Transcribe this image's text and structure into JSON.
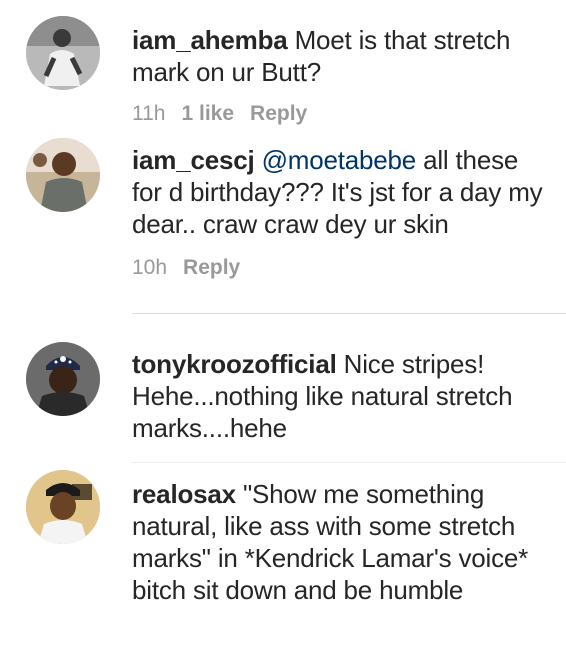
{
  "comments": [
    {
      "username": "iam_ahemba",
      "text": "Moet is that stretch mark on ur Butt?",
      "time": "11h",
      "likes": "1 like",
      "reply": "Reply"
    },
    {
      "username": "iam_cescj",
      "mention": "@moetabebe",
      "text": "all these for d birthday??? It's jst for a day my dear.. craw craw dey ur skin",
      "time": "10h",
      "reply": "Reply"
    },
    {
      "username": "tonykroozofficial",
      "text": "Nice stripes! Hehe...nothing like natural stretch marks....hehe"
    },
    {
      "username": "realosax",
      "text": "\"Show me something natural, like ass with some stretch marks\" in *Kendrick Lamar's voice* bitch sit down and be humble"
    }
  ],
  "colors": {
    "text": "#262626",
    "meta": "#999999",
    "mention": "#003569",
    "divider": "#dbdbdb"
  }
}
